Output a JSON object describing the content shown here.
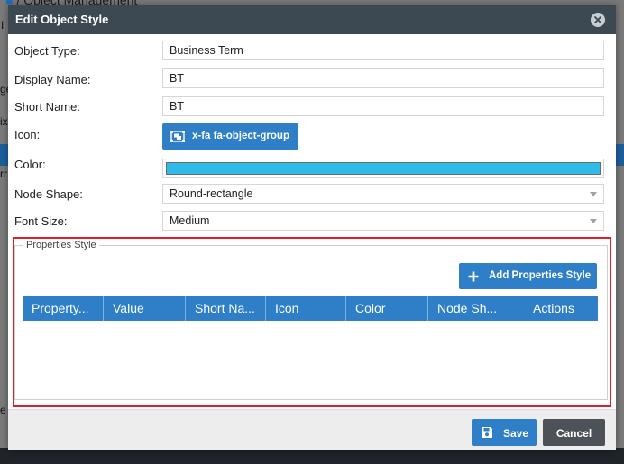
{
  "background": {
    "breadcrumb_text": "/ Object Management",
    "breadcrumb_icon": "home-icon",
    "left_strip_letters": [
      "I",
      "ge",
      "ix",
      "rr",
      "e"
    ]
  },
  "modal": {
    "title": "Edit Object Style",
    "close_icon": "close-icon",
    "fields": {
      "object_type": {
        "label": "Object Type:",
        "value": "Business Term"
      },
      "display_name": {
        "label": "Display Name:",
        "value": "BT"
      },
      "short_name": {
        "label": "Short Name:",
        "value": "BT"
      },
      "icon": {
        "label": "Icon:",
        "button_label": "x-fa fa-object-group",
        "icon_name": "object-group-icon"
      },
      "color": {
        "label": "Color:",
        "value_color": "#2fbbe9"
      },
      "node_shape": {
        "label": "Node Shape:",
        "selected": "Round-rectangle"
      },
      "font_size": {
        "label": "Font Size:",
        "selected": "Medium"
      }
    },
    "properties_style": {
      "legend": "Properties Style",
      "add_button_label": "Add Properties Style",
      "columns": [
        "Property...",
        "Value",
        "Short Na...",
        "Icon",
        "Color",
        "Node Sh...",
        "Actions"
      ],
      "rows": []
    },
    "footer": {
      "save_label": "Save",
      "cancel_label": "Cancel"
    }
  },
  "colors": {
    "header_bg": "#3c4852",
    "accent_blue": "#2e7fc7",
    "highlight_red": "#e01e2a",
    "cancel_bg": "#4c5257"
  }
}
